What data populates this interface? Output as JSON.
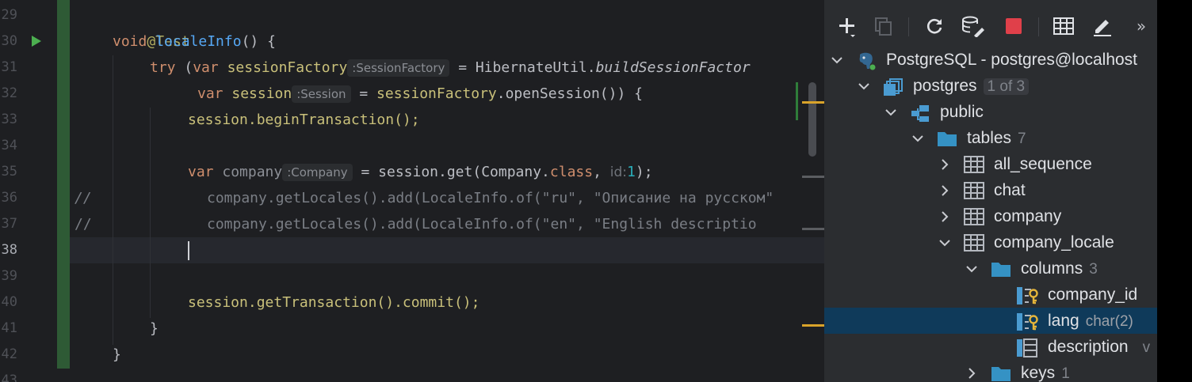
{
  "editor": {
    "line_numbers": [
      "29",
      "30",
      "31",
      "32",
      "33",
      "34",
      "35",
      "36",
      "37",
      "38",
      "39",
      "40",
      "41",
      "42",
      "43"
    ],
    "lines": {
      "l29": {
        "annotation": "@Test"
      },
      "l30": {
        "kw_void": "void",
        "method_name": "localeInfo",
        "rest": "() {"
      },
      "l31": {
        "kw_try": "try",
        "paren": " (",
        "kw_var": "var",
        "name": "sessionFactory",
        "hint": ":SessionFactory",
        "eq": " = HibernateUtil.",
        "call": "buildSessionFactor"
      },
      "l32": {
        "kw_var": "var",
        "name": "session",
        "hint": ":Session",
        "eq": " = ",
        "obj": "sessionFactory",
        "rest": ".openSession()) {"
      },
      "l33": {
        "text": "session.beginTransaction();"
      },
      "l35": {
        "kw_var": "var",
        "name": "company",
        "hint": ":Company",
        "eq": " = session.get(Company.",
        "kw_class": "class",
        "comma": ", ",
        "param_hint": "id:",
        "num": "1",
        "end": ");"
      },
      "l36": {
        "comment_mark": "//",
        "code": "company.getLocales().add(LocaleInfo.of(",
        "s1": "\"ru\"",
        "sep": ", ",
        "s2": "\"Описание на русском\""
      },
      "l37": {
        "comment_mark": "//",
        "code": "company.getLocales().add(LocaleInfo.of(",
        "s1": "\"en\"",
        "sep": ", ",
        "s2": "\"English descriptio"
      },
      "l40": {
        "text": "session.getTransaction().commit();"
      },
      "l41": {
        "text": "}"
      },
      "l42": {
        "text": "}"
      }
    }
  },
  "database_panel": {
    "toolbar": [
      "add-icon",
      "duplicate-icon",
      "refresh-icon",
      "schema-sync-icon",
      "stop-icon",
      "table-view-icon",
      "edit-icon",
      "more-icon"
    ],
    "more_label": "»",
    "tree": [
      {
        "label": "PostgreSQL - postgres@localhost",
        "expanded": true
      },
      {
        "label": "postgres",
        "badge": "1 of 3",
        "expanded": true
      },
      {
        "label": "public",
        "expanded": true
      },
      {
        "label": "tables",
        "count": "7",
        "expanded": true
      },
      {
        "label": "all_sequence",
        "expanded": false
      },
      {
        "label": "chat",
        "expanded": false
      },
      {
        "label": "company",
        "expanded": false
      },
      {
        "label": "company_locale",
        "expanded": true
      },
      {
        "label": "columns",
        "count": "3",
        "expanded": true
      },
      {
        "label": "company_id"
      },
      {
        "label": "lang",
        "type": "char(2)",
        "selected": true
      },
      {
        "label": "description",
        "type": "v"
      },
      {
        "label": "keys",
        "count": "1",
        "expanded": false
      }
    ]
  },
  "colors": {
    "editor_bg": "#1e1f22",
    "panel_bg": "#2b2d30",
    "selection": "#0f3a5a",
    "keyword": "#cf8e6d",
    "method": "#56a8f5",
    "string": "#6aab73",
    "annotation": "#b3ae60"
  }
}
